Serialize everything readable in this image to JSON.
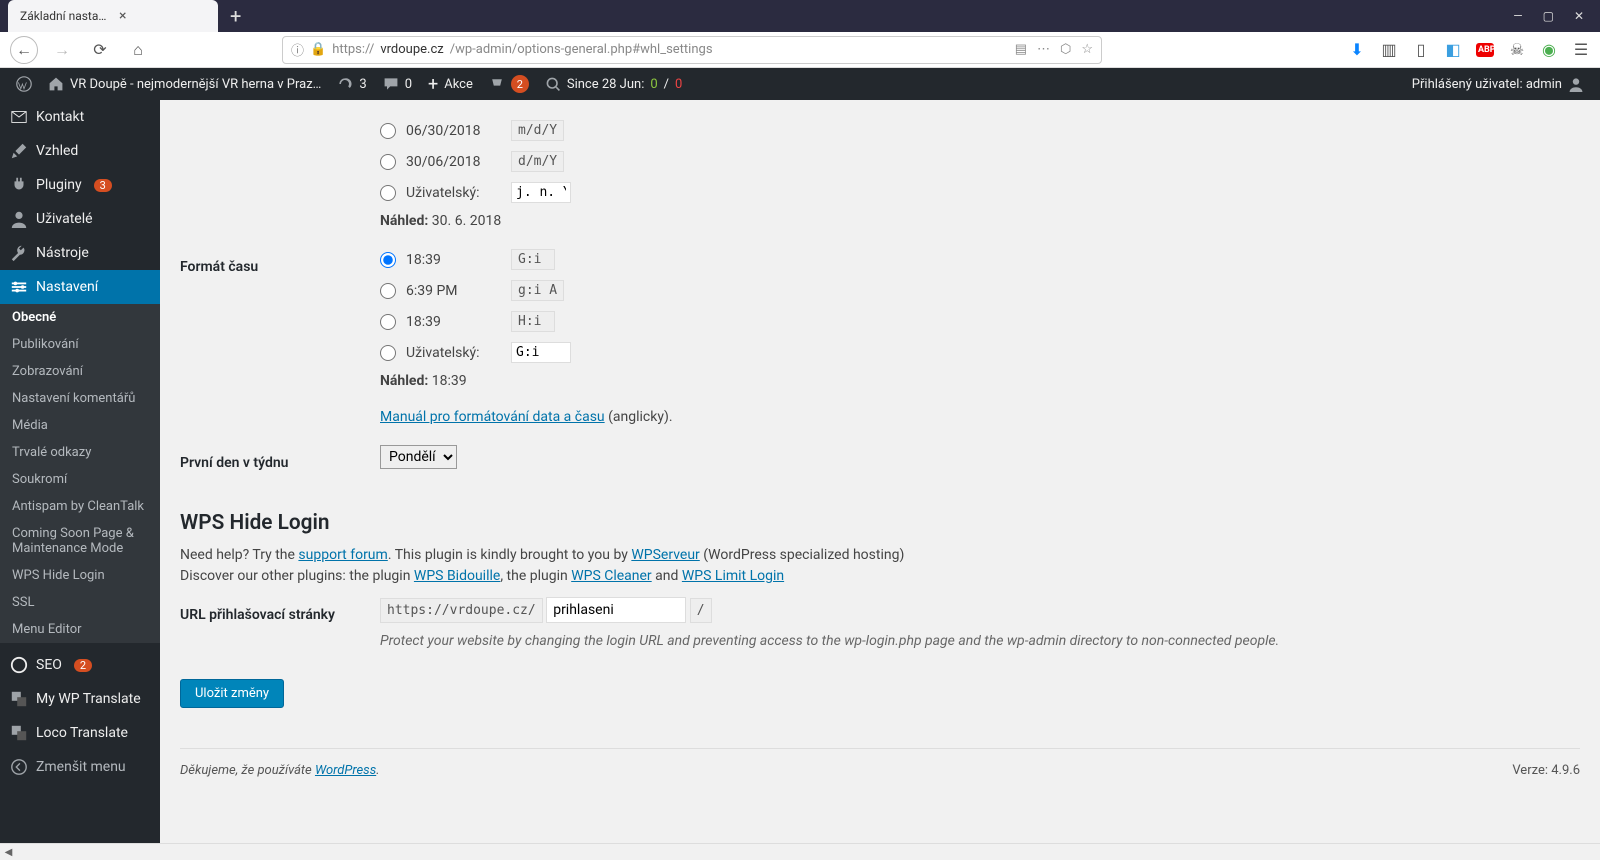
{
  "browser": {
    "tab_title": "Základní nastavení ‹ VR Doupě - ne…",
    "url_prefix": "https://",
    "url_host": "vrdoupe.cz",
    "url_path": "/wp-admin/options-general.php#whl_settings"
  },
  "adminbar": {
    "site_name": "VR Doupě - nejmodernější VR herna v Praz…",
    "updates_count": "3",
    "comments_count": "0",
    "new_label": "Akce",
    "notif_count": "2",
    "since_label": "Since 28 Jun:",
    "since_ok": "0",
    "since_sep": " / ",
    "since_bad": "0",
    "howdy": "Přihlášený uživatel: admin"
  },
  "sidebar": {
    "items": [
      {
        "label": "Kontakt",
        "icon": "mail"
      },
      {
        "label": "Vzhled",
        "icon": "brush"
      },
      {
        "label": "Pluginy",
        "icon": "plugin",
        "count": "3"
      },
      {
        "label": "Uživatelé",
        "icon": "user"
      },
      {
        "label": "Nástroje",
        "icon": "wrench"
      },
      {
        "label": "Nastavení",
        "icon": "settings",
        "current": true
      }
    ],
    "submenu": [
      {
        "label": "Obecné",
        "current": true
      },
      {
        "label": "Publikování"
      },
      {
        "label": "Zobrazování"
      },
      {
        "label": "Nastavení komentářů"
      },
      {
        "label": "Média"
      },
      {
        "label": "Trvalé odkazy"
      },
      {
        "label": "Soukromí"
      },
      {
        "label": "Antispam by CleanTalk"
      },
      {
        "label": "Coming Soon Page & Maintenance Mode"
      },
      {
        "label": "WPS Hide Login"
      },
      {
        "label": "SSL"
      },
      {
        "label": "Menu Editor"
      }
    ],
    "after": [
      {
        "label": "SEO",
        "icon": "seo",
        "count": "2"
      },
      {
        "label": "My WP Translate",
        "icon": "translate"
      },
      {
        "label": "Loco Translate",
        "icon": "translate"
      }
    ],
    "collapse": "Zmenšit menu"
  },
  "content": {
    "date_options": [
      {
        "label": "06/30/2018",
        "code": "m/d/Y"
      },
      {
        "label": "30/06/2018",
        "code": "d/m/Y"
      }
    ],
    "date_custom_label": "Uživatelský:",
    "date_custom_value": "j. n. Y",
    "date_preview_label": "Náhled:",
    "date_preview_value": "30. 6. 2018",
    "time_heading": "Formát času",
    "time_options": [
      {
        "label": "18:39",
        "code": "G:i",
        "checked": true
      },
      {
        "label": "6:39 PM",
        "code": "g:i A"
      },
      {
        "label": "18:39",
        "code": "H:i"
      }
    ],
    "time_custom_label": "Uživatelský:",
    "time_custom_value": "G:i",
    "time_preview_label": "Náhled:",
    "time_preview_value": "18:39",
    "manual_link": "Manuál pro formátování data a času",
    "manual_suffix": " (anglicky).",
    "week_heading": "První den v týdnu",
    "week_value": "Pondělí",
    "wps_heading": "WPS Hide Login",
    "wps_help1": "Need help? Try the ",
    "wps_link1": "support forum",
    "wps_help2": ". This plugin is kindly brought to you by ",
    "wps_link2": "WPServeur",
    "wps_help3": " (WordPress specialized hosting)",
    "wps_help4": "Discover our other plugins: the plugin ",
    "wps_link3": "WPS Bidouille",
    "wps_help5": ", the plugin ",
    "wps_link4": "WPS Cleaner",
    "wps_help6": " and ",
    "wps_link5": "WPS Limit Login",
    "login_url_label": "URL přihlašovací stránky",
    "login_url_prefix": "https://vrdoupe.cz/",
    "login_url_value": "prihlaseni",
    "login_url_suffix": "/",
    "login_desc": "Protect your website by changing the login URL and preventing access to the wp-login.php page and the wp-admin directory to non-connected people.",
    "submit": "Uložit změny"
  },
  "footer": {
    "thanks_prefix": "Děkujeme, že používáte ",
    "thanks_link": "WordPress",
    "version": "Verze: 4.9.6"
  }
}
